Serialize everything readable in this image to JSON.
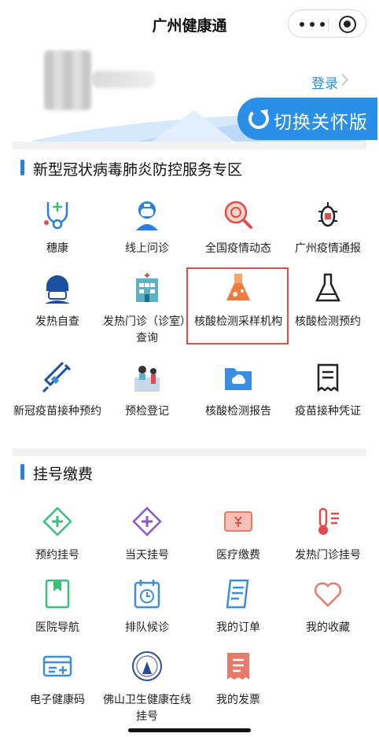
{
  "nav": {
    "title": "广州健康通"
  },
  "banner": {
    "login_label": "登录",
    "switch_label": "切换关怀版"
  },
  "covid_section": {
    "title": "新型冠状病毒肺炎防控服务专区",
    "items": [
      {
        "label": "穗康",
        "icon": "health-code-icon"
      },
      {
        "label": "线上问诊",
        "icon": "online-doctor-icon"
      },
      {
        "label": "全国疫情动态",
        "icon": "virus-search-icon"
      },
      {
        "label": "广州疫情通报",
        "icon": "virus-bulletin-icon"
      },
      {
        "label": "发热自查",
        "icon": "self-check-icon"
      },
      {
        "label": "发热门诊（诊室）查询",
        "icon": "hospital-icon"
      },
      {
        "label": "核酸检测采样机构",
        "icon": "flask-icon"
      },
      {
        "label": "核酸检测预约",
        "icon": "flask-outline-icon"
      },
      {
        "label": "新冠疫苗接种预约",
        "icon": "syringe-icon"
      },
      {
        "label": "预检登记",
        "icon": "registration-desk-icon"
      },
      {
        "label": "核酸检测报告",
        "icon": "cloud-folder-icon"
      },
      {
        "label": "疫苗接种凭证",
        "icon": "receipt-scroll-icon"
      }
    ]
  },
  "registration_section": {
    "title": "挂号缴费",
    "items": [
      {
        "label": "预约挂号",
        "icon": "plus-diamond-icon"
      },
      {
        "label": "当天挂号",
        "icon": "plus-diamond-purple-icon"
      },
      {
        "label": "医疗缴费",
        "icon": "payment-card-icon"
      },
      {
        "label": "发热门诊挂号",
        "icon": "thermometer-icon"
      },
      {
        "label": "医院导航",
        "icon": "map-bookmark-icon"
      },
      {
        "label": "排队候诊",
        "icon": "clock-calendar-icon"
      },
      {
        "label": "我的订单",
        "icon": "order-doc-icon"
      },
      {
        "label": "我的收藏",
        "icon": "heart-icon"
      },
      {
        "label": "电子健康码",
        "icon": "health-card-icon"
      },
      {
        "label": "佛山卫生健康在线挂号",
        "icon": "foshan-emblem-icon"
      },
      {
        "label": "我的发票",
        "icon": "invoice-icon"
      }
    ]
  },
  "colors": {
    "accent": "#2a8fe6",
    "highlight": "#e04b4b",
    "section_bar": "#2a7de1"
  }
}
